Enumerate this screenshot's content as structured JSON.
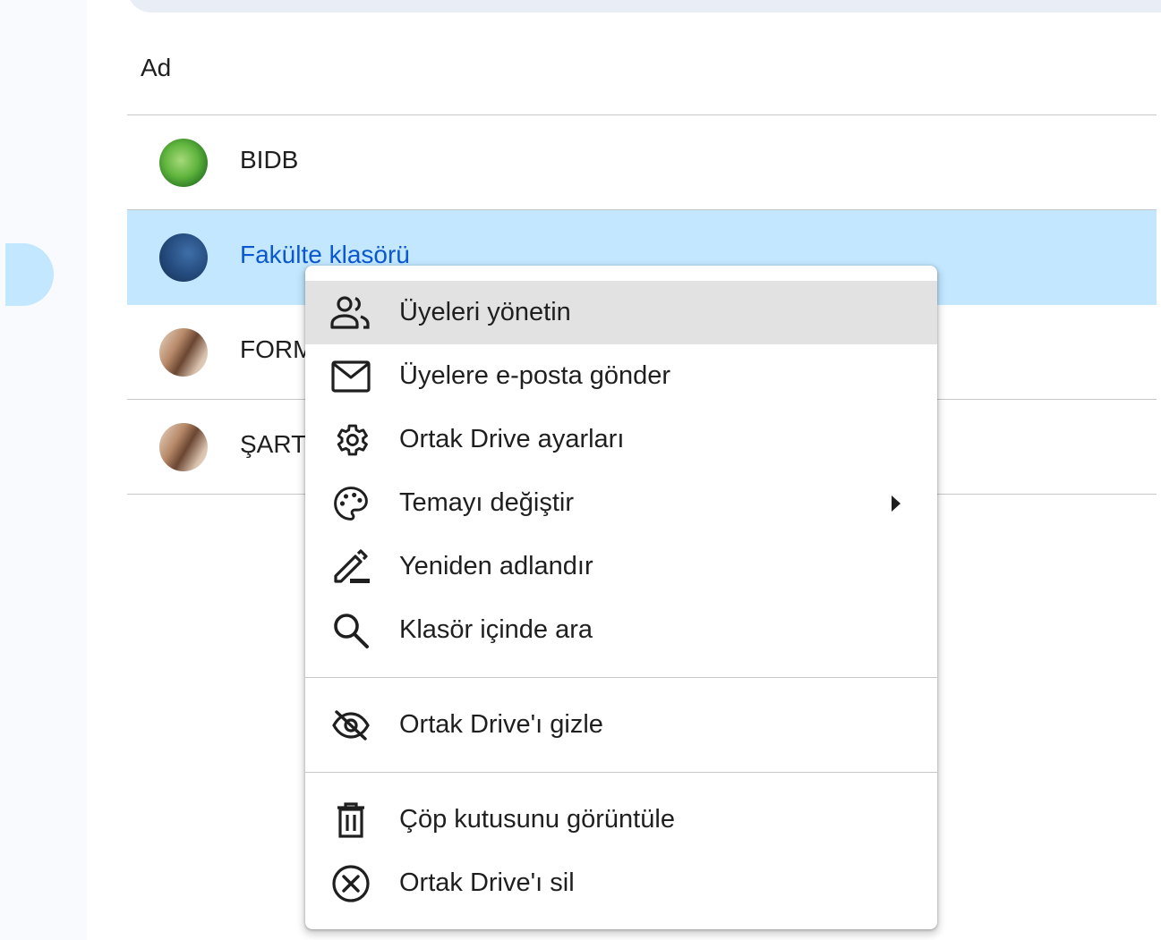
{
  "list": {
    "column_header": "Ad",
    "rows": [
      {
        "name": "BIDB",
        "avatar": "green-leaf-avatar",
        "selected": false
      },
      {
        "name": "Fakülte klasörü",
        "avatar": "blue-fabric-avatar",
        "selected": true
      },
      {
        "name": "FORM",
        "avatar": "portrait-avatar",
        "selected": false
      },
      {
        "name": "ŞART",
        "avatar": "portrait-avatar",
        "selected": false
      }
    ]
  },
  "context_menu": {
    "items": [
      {
        "label": "Üyeleri yönetin",
        "icon": "manage-members-icon"
      },
      {
        "label": "Üyelere e-posta gönder",
        "icon": "mail-icon"
      },
      {
        "label": "Ortak Drive ayarları",
        "icon": "gear-icon"
      },
      {
        "label": "Temayı değiştir",
        "icon": "palette-icon",
        "has_submenu": true
      },
      {
        "label": "Yeniden adlandır",
        "icon": "rename-pen-icon"
      },
      {
        "label": "Klasör içinde ara",
        "icon": "search-icon"
      }
    ],
    "group2": [
      {
        "label": "Ortak Drive'ı gizle",
        "icon": "eye-off-icon"
      }
    ],
    "group3": [
      {
        "label": "Çöp kutusunu görüntüle",
        "icon": "trash-icon"
      },
      {
        "label": "Ortak Drive'ı sil",
        "icon": "close-circle-icon"
      }
    ]
  },
  "colors": {
    "selected_row": "#c2e7ff",
    "selected_text": "#0b57d0",
    "menu_hover": "#e2e2e2"
  }
}
